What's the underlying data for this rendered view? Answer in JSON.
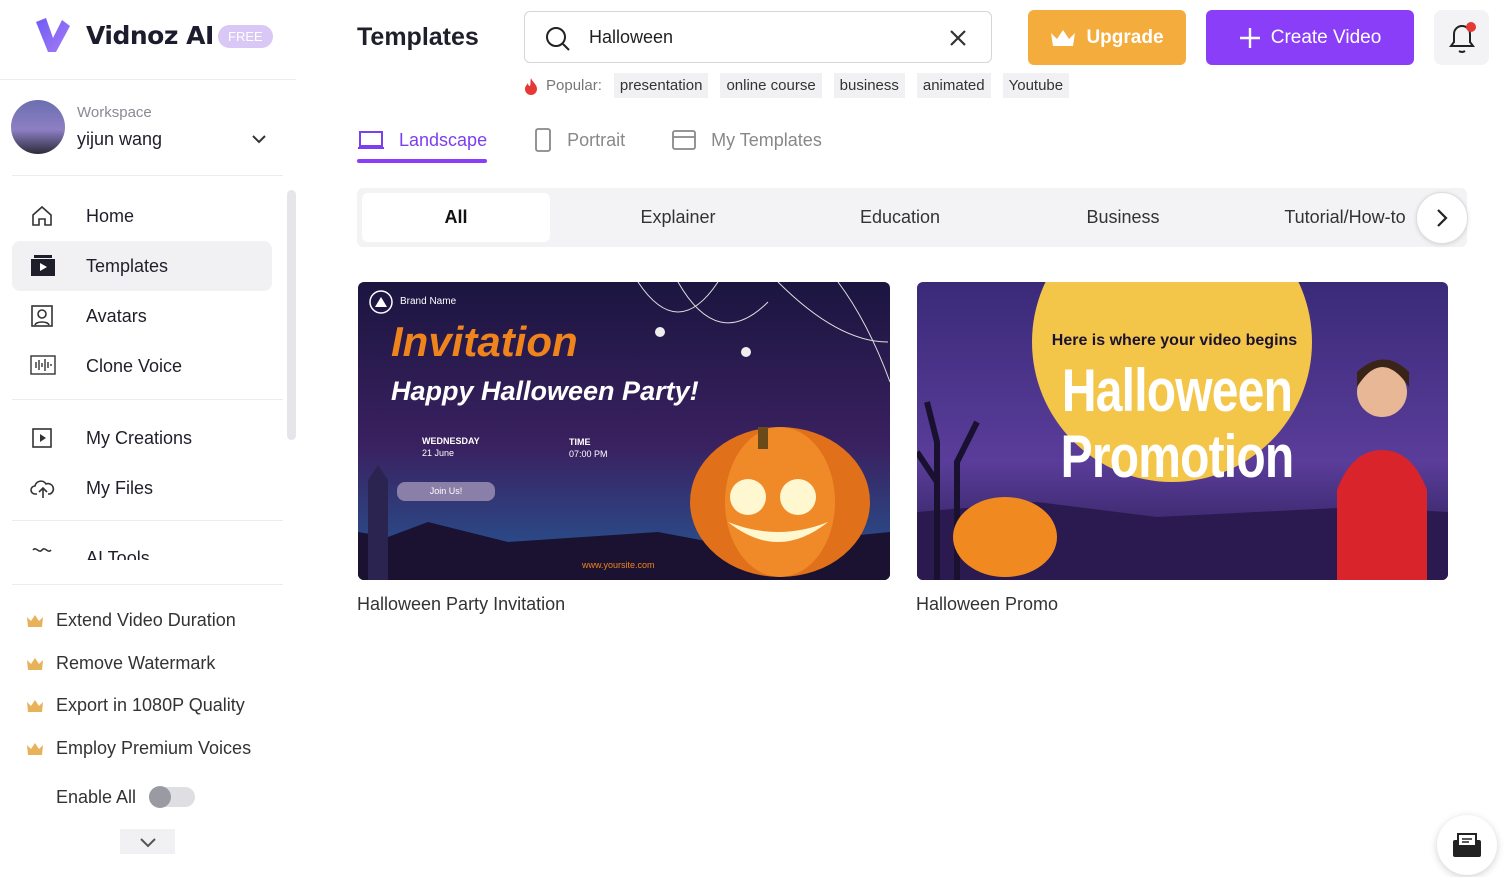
{
  "brand": {
    "name": "Vidnoz AI",
    "plan_badge": "FREE"
  },
  "workspace": {
    "label": "Workspace",
    "user": "yijun wang"
  },
  "sidebar": {
    "items": [
      {
        "label": "Home",
        "icon": "home-icon"
      },
      {
        "label": "Templates",
        "icon": "templates-icon",
        "active": true
      },
      {
        "label": "Avatars",
        "icon": "avatar-icon"
      },
      {
        "label": "Clone Voice",
        "icon": "voice-icon"
      },
      {
        "label": "My Creations",
        "icon": "play-icon"
      },
      {
        "label": "My Files",
        "icon": "upload-cloud-icon"
      },
      {
        "label": "AI Tools",
        "icon": "ai-tools-icon"
      }
    ],
    "perks": [
      "Extend Video Duration",
      "Remove Watermark",
      "Export in 1080P Quality",
      "Employ Premium Voices"
    ],
    "enable_all": {
      "label": "Enable All",
      "on": false
    }
  },
  "header": {
    "title": "Templates",
    "search": {
      "value": "Halloween",
      "placeholder": ""
    },
    "upgrade_label": "Upgrade",
    "create_label": "Create Video",
    "popular_label": "Popular:",
    "popular_tags": [
      "presentation",
      "online course",
      "business",
      "animated",
      "Youtube"
    ]
  },
  "tabs": [
    {
      "label": "Landscape",
      "active": true
    },
    {
      "label": "Portrait"
    },
    {
      "label": "My Templates"
    }
  ],
  "categories": [
    {
      "label": "All",
      "active": true
    },
    {
      "label": "Explainer"
    },
    {
      "label": "Education"
    },
    {
      "label": "Business"
    },
    {
      "label": "Tutorial/How-to"
    }
  ],
  "templates": [
    {
      "title": "Halloween Party Invitation",
      "thumb": {
        "brand": "Brand Name",
        "heading": "Invitation",
        "sub": "Happy Halloween Party!",
        "day": "WEDNESDAY",
        "date": "21 June",
        "time_label": "TIME",
        "time": "07:00 PM",
        "cta": "Join Us!",
        "site": "www.yoursite.com"
      }
    },
    {
      "title": "Halloween Promo",
      "thumb": {
        "tagline": "Here is where your video begins",
        "line1": "Halloween",
        "line2": "Promotion"
      }
    }
  ],
  "colors": {
    "accent": "#8b3ef8",
    "upgrade": "#f4ac3c",
    "notification_dot": "#e53935"
  }
}
